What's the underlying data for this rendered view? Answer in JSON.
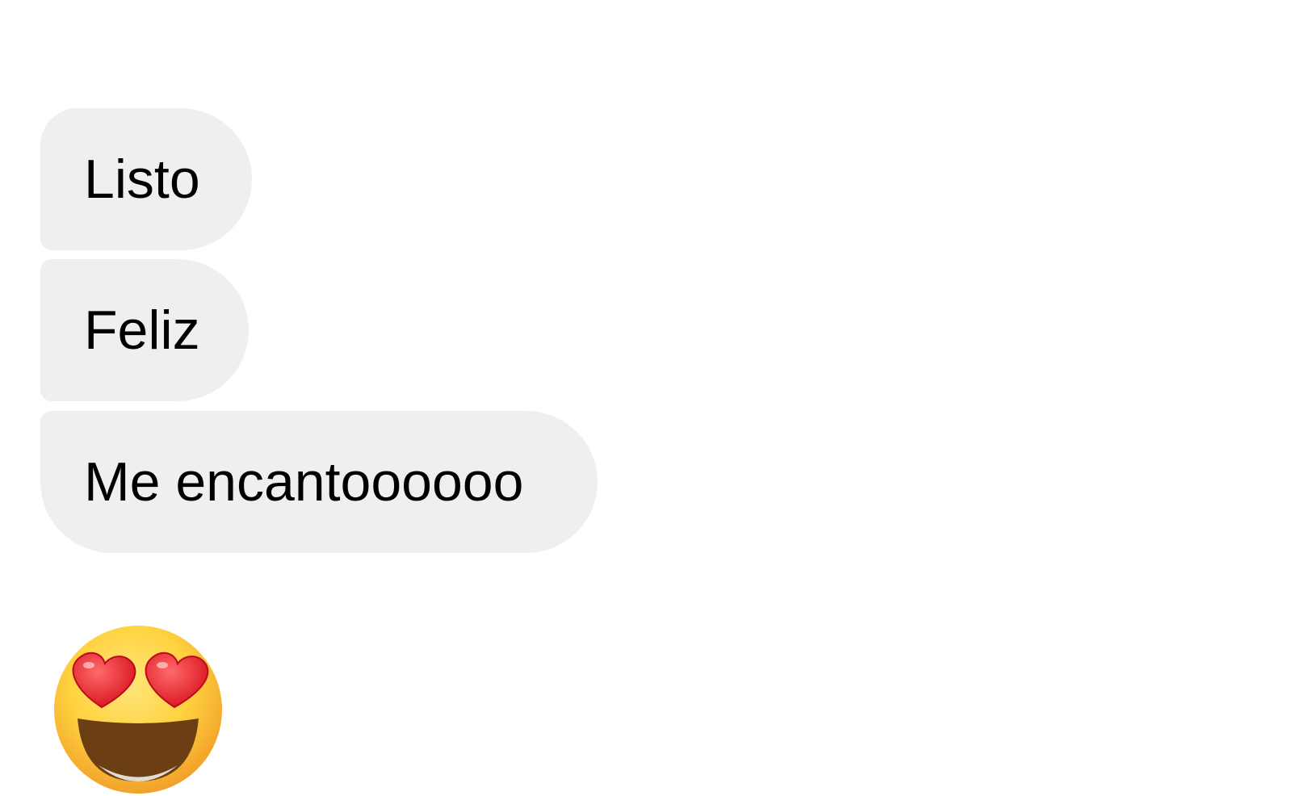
{
  "messages": [
    {
      "text": "Listo"
    },
    {
      "text": "Feliz"
    },
    {
      "text": "Me encantoooooo"
    }
  ],
  "reaction": {
    "icon": "heart-eyes-emoji"
  },
  "colors": {
    "background": "#ffffff",
    "bubble": "#efefef",
    "text": "#000000"
  }
}
